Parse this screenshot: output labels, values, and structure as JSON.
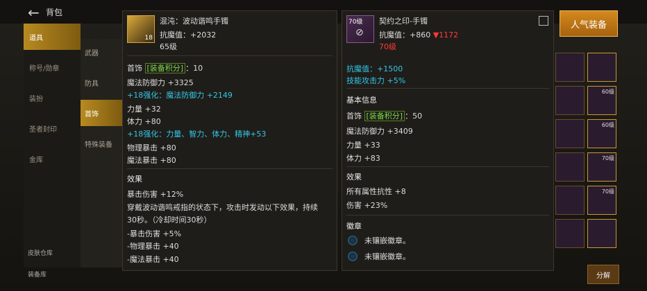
{
  "header": {
    "bag_title": "背包"
  },
  "left_nav": [
    "道具",
    "称号/勋章",
    "装扮",
    "圣者封印",
    "金库"
  ],
  "sub_nav": [
    "武器",
    "防具",
    "首饰",
    "特殊装备"
  ],
  "bottom_nav": [
    "皮肤仓库",
    "装备库"
  ],
  "item_left": {
    "name": "混沌：波动谐鸣手镯",
    "resist": "抗魔值：+2032",
    "level": "65级",
    "enhance_badge": "18",
    "slot_prefix": "首饰",
    "score_label": "装备积分",
    "score_value": "：10",
    "stats": [
      "魔法防御力 +3325",
      "+18强化：魔法防御力 +2149",
      "力量 +32",
      "体力 +80",
      "+18强化：力量、智力、体力、精神+53",
      "物理暴击 +80",
      "魔法暴击 +80"
    ],
    "effect_title": "效果",
    "effects": [
      "暴击伤害 +12%",
      "穿戴波动谐鸣戒指的状态下，攻击时发动以下效果，持续",
      "30秒。（冷却时间30秒）",
      "-暴击伤害 +5%",
      "-物理暴击 +40",
      "-魔法暴击 +40"
    ]
  },
  "item_right": {
    "name": "契约之印-手镯",
    "level_badge": "70级",
    "resist": "抗魔值：+860",
    "resist_diff": "▼1172",
    "level": "70级",
    "top_stats": [
      "抗魔值：+1500",
      "技能攻击力 +5%"
    ],
    "basic_title": "基本信息",
    "slot_prefix": "首饰",
    "score_label": "装备积分",
    "score_value": "：50",
    "stats": [
      "魔法防御力 +3409",
      "力量 +33",
      "体力 +83"
    ],
    "effect_title": "效果",
    "effects": [
      "所有属性抗性 +8",
      "伤害 +23%"
    ],
    "emblem_title": "徽章",
    "emblems": [
      "未镶嵌徽章。",
      "未镶嵌徽章。"
    ]
  },
  "hot_button": "人气装备",
  "bottom_buttons": [
    "分解"
  ],
  "slot_labels": [
    "60级",
    "60级",
    "70级",
    "70级"
  ],
  "colors": {
    "pink": "#ff4ad9",
    "cyan": "#32c6e8",
    "gold": "#d4891f",
    "red": "#ff3b3b"
  }
}
